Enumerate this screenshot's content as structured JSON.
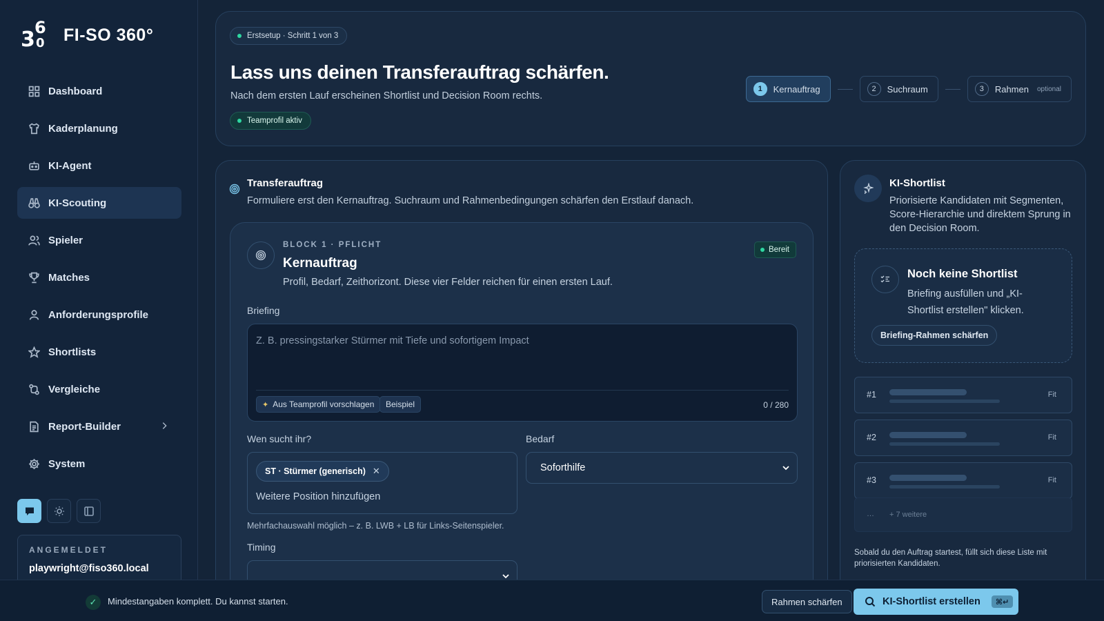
{
  "brand": {
    "logo_text": "360",
    "name": "FI-SO 360°"
  },
  "nav": [
    {
      "label": "Dashboard",
      "icon": "grid-icon"
    },
    {
      "label": "Kaderplanung",
      "icon": "shirt-icon"
    },
    {
      "label": "KI-Agent",
      "icon": "robot-icon"
    },
    {
      "label": "KI-Scouting",
      "icon": "binoculars-icon",
      "active": true
    },
    {
      "label": "Spieler",
      "icon": "users-icon"
    },
    {
      "label": "Matches",
      "icon": "trophy-icon"
    },
    {
      "label": "Anforderungsprofile",
      "icon": "user-icon"
    },
    {
      "label": "Shortlists",
      "icon": "star-icon"
    },
    {
      "label": "Vergleiche",
      "icon": "compare-icon"
    },
    {
      "label": "Report-Builder",
      "icon": "document-icon"
    },
    {
      "label": "System",
      "icon": "gear-icon"
    }
  ],
  "login": {
    "label": "ANGEMELDET",
    "user": "playwright@fiso360.local"
  },
  "header": {
    "setup_pill": "Erstsetup · Schritt 1 von 3",
    "title": "Lass uns deinen Transferauftrag schärfen.",
    "subtitle": "Nach dem ersten Lauf erscheinen Shortlist und Decision Room rechts.",
    "team_pill": "Teamprofil aktiv",
    "steps": [
      {
        "num": "1",
        "label": "Kernauftrag"
      },
      {
        "num": "2",
        "label": "Suchraum"
      },
      {
        "num": "3",
        "label": "Rahmen",
        "note": "optional"
      }
    ]
  },
  "main": {
    "title": "Transferauftrag",
    "subtitle": "Formuliere erst den Kernauftrag. Suchraum und Rahmenbedingungen schärfen den Erstlauf danach.",
    "block": {
      "kicker": "BLOCK 1 · PFLICHT",
      "title": "Kernauftrag",
      "subtitle": "Profil, Bedarf, Zeithorizont. Diese vier Felder reichen für einen ersten Lauf.",
      "status": "Bereit",
      "briefing_label": "Briefing",
      "briefing_placeholder": "Z. B. pressingstarker Stürmer mit Tiefe und sofortigem Impact",
      "suggest_chip": "Aus Teamprofil vorschlagen",
      "example_chip": "Beispiel",
      "counter": "0 / 280",
      "position_label": "Wen sucht ihr?",
      "position_tag": "ST · Stürmer (generisch)",
      "position_placeholder": "Weitere Position hinzufügen",
      "position_hint": "Mehrfachauswahl möglich – z. B. LWB + LB für Links-Seitenspieler.",
      "need_label": "Bedarf",
      "need_value": "Soforthilfe",
      "timing_label": "Timing"
    }
  },
  "shortlist": {
    "title": "KI-Shortlist",
    "subtitle": "Priorisierte Kandidaten mit Segmenten, Score-Hierarchie und direktem Sprung in den Decision Room.",
    "empty_title": "Noch keine Shortlist",
    "empty_text": "Briefing ausfüllen und „KI-Shortlist erstellen\" klicken.",
    "empty_button": "Briefing-Rahmen schärfen",
    "ranks": [
      {
        "num": "#1",
        "fit": "Fit"
      },
      {
        "num": "#2",
        "fit": "Fit"
      },
      {
        "num": "#3",
        "fit": "Fit"
      }
    ],
    "more_dots": "…",
    "more_text": "+ 7 weitere",
    "footer": "Sobald du den Auftrag startest, füllt sich diese Liste mit priorisierten Kandidaten."
  },
  "bottombar": {
    "status": "Mindestangaben komplett. Du kannst starten.",
    "secondary_button": "Rahmen schärfen",
    "primary_button": "KI-Shortlist erstellen",
    "shortcut": "⌘↵"
  },
  "colors": {
    "accent": "#7cc8ec",
    "success": "#2ed7a1",
    "background": "#142438"
  }
}
